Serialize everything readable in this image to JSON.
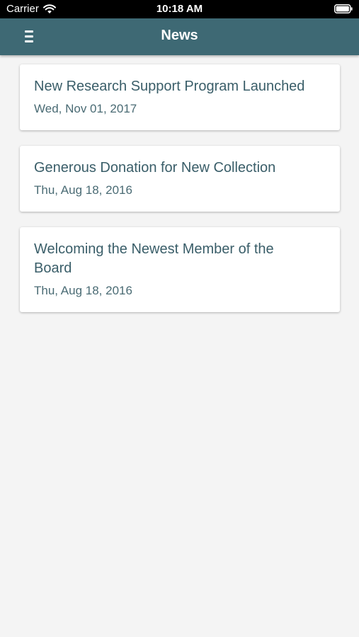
{
  "status_bar": {
    "carrier": "Carrier",
    "time": "10:18 AM"
  },
  "header": {
    "title": "News",
    "menu_icon": "hamburger-menu-icon"
  },
  "news": [
    {
      "title": "New Research Support Program Launched",
      "date": "Wed, Nov 01, 2017"
    },
    {
      "title": "Generous Donation for New Collection",
      "date": "Thu, Aug 18, 2016"
    },
    {
      "title": "Welcoming the Newest Member of the Board",
      "date": "Thu, Aug 18, 2016"
    }
  ],
  "colors": {
    "header_bg": "#3e6974",
    "title_text": "#3a5e69",
    "page_bg": "#f4f4f4"
  }
}
